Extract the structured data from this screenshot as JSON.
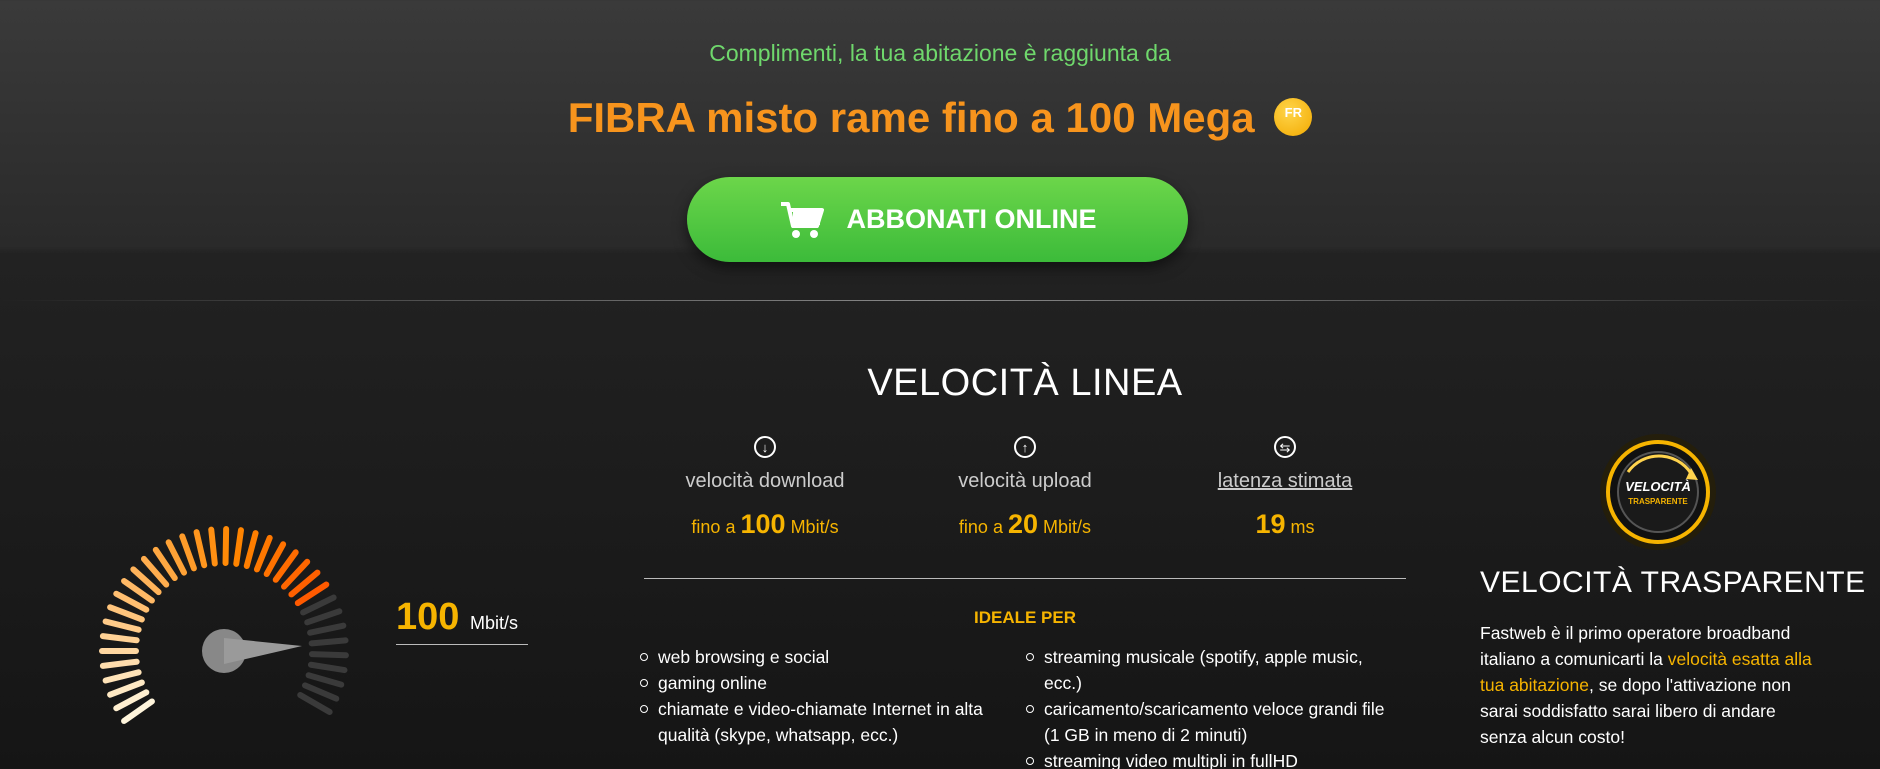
{
  "hero": {
    "congrats": "Complimenti, la tua abitazione è raggiunta da",
    "headline": "FIBRA misto rame fino a 100 Mega",
    "badge": "FR",
    "cta_label": "ABBONATI ONLINE"
  },
  "speed": {
    "title": "VELOCITÀ LINEA",
    "download": {
      "label": "velocità download",
      "prefix": "fino a",
      "value": "100",
      "unit": "Mbit/s"
    },
    "upload": {
      "label": "velocità upload",
      "prefix": "fino a",
      "value": "20",
      "unit": "Mbit/s"
    },
    "latency": {
      "label": "latenza stimata",
      "value": "19",
      "unit": "ms"
    }
  },
  "gauge": {
    "value": "100",
    "unit": "Mbit/s",
    "level": 0.74
  },
  "ideal": {
    "heading": "IDEALE PER",
    "left": [
      "web browsing e social",
      "gaming online",
      "chiamate e video-chiamate Internet in alta qualità (skype, whatsapp, ecc.)"
    ],
    "right": [
      "streaming musicale (spotify, apple music, ecc.)",
      "caricamento/scaricamento veloce grandi file (1 GB in meno di 2 minuti)",
      "streaming video multipli in fullHD"
    ]
  },
  "transparent": {
    "badge_line1": "VELOCITÀ",
    "badge_line2": "TRASPARENTE",
    "title": "VELOCITÀ TRASPARENTE",
    "text_before": "Fastweb è il primo operatore broadband italiano a comunicarti la ",
    "text_highlight": "velocità esatta alla tua abitazione",
    "text_after": ", se dopo l'attivazione non sarai soddisfatto sarai libero di andare senza alcun costo!"
  },
  "colors": {
    "accent_orange": "#f7941d",
    "accent_yellow": "#f6b400",
    "cta_green": "#4cc442",
    "congrats_green": "#6fd86c"
  }
}
